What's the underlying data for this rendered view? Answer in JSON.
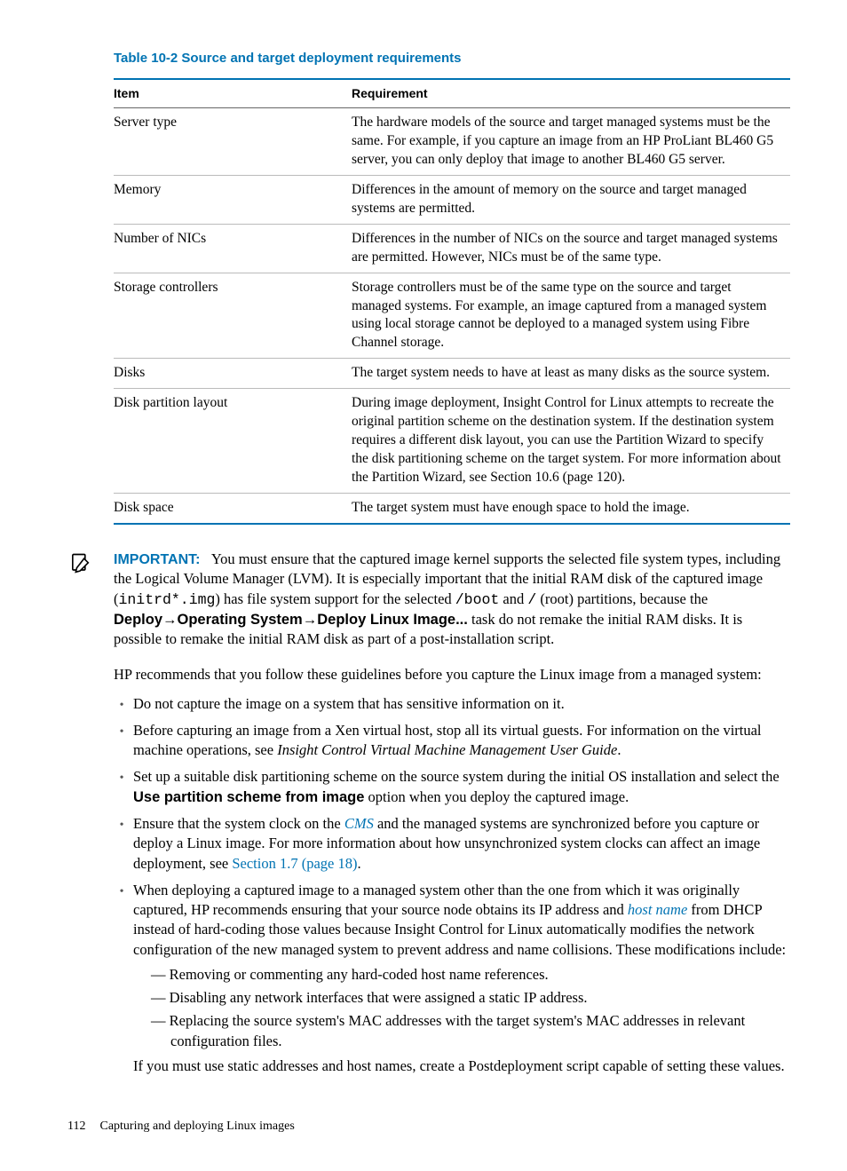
{
  "table": {
    "caption": "Table 10-2 Source and target deployment requirements",
    "header_item": "Item",
    "header_req": "Requirement",
    "rows": [
      {
        "item": "Server type",
        "req": "The hardware models of the source and target managed systems must be the same. For example, if you capture an image from an HP ProLiant BL460 G5 server, you can only deploy that image to another BL460 G5 server."
      },
      {
        "item": "Memory",
        "req": "Differences in the amount of memory on the source and target managed systems are permitted."
      },
      {
        "item": "Number of NICs",
        "req": "Differences in the number of NICs on the source and target managed systems are permitted. However, NICs must be of the same type."
      },
      {
        "item": "Storage controllers",
        "req": "Storage controllers must be of the same type on the source and target managed systems. For example, an image captured from a managed system using local storage cannot be deployed to a managed system using Fibre Channel storage."
      },
      {
        "item": "Disks",
        "req": "The target system needs to have at least as many disks as the source system."
      },
      {
        "item": "Disk partition layout",
        "req": "During image deployment, Insight Control for Linux attempts to recreate the original partition scheme on the destination system. If the destination system requires a different disk layout, you can use the Partition Wizard to specify the disk partitioning scheme on the target system. For more information about the Partition Wizard, see Section 10.6 (page 120)."
      },
      {
        "item": "Disk space",
        "req": "The target system must have enough space to hold the image."
      }
    ]
  },
  "important": {
    "label": "IMPORTANT:",
    "pre1": "You must ensure that the captured image kernel supports the selected file system types, including the Logical Volume Manager (LVM). It is especially important that the initial RAM disk of the captured image (",
    "mono1": "initrd*.img",
    "mid1": ") has file system support for the selected ",
    "mono2": "/boot",
    "mid2": " and ",
    "mono3": "/",
    "mid3": " (root) partitions, because the ",
    "bold1": "Deploy",
    "arrow": "→",
    "bold2": "Operating System",
    "bold3": "Deploy Linux Image...",
    "post1": " task do not remake the initial RAM disks. It is possible to remake the initial RAM disk as part of a post-installation script."
  },
  "para_intro": "HP recommends that you follow these guidelines before you capture the Linux image from a managed system:",
  "bullets": {
    "b1": "Do not capture the image on a system that has sensitive information on it.",
    "b2a": "Before capturing an image from a Xen virtual host, stop all its virtual guests. For information on the virtual machine operations, see ",
    "b2_italic": "Insight Control Virtual Machine Management User Guide",
    "b2b": ".",
    "b3a": "Set up a suitable disk partitioning scheme on the source system during the initial OS installation and select the ",
    "b3_bold": "Use partition scheme from image",
    "b3b": " option when you deploy the captured image.",
    "b4a": "Ensure that the system clock on the ",
    "b4_link1": "CMS",
    "b4b": " and the managed systems are synchronized before you capture or deploy a Linux image. For more information about how unsynchronized system clocks can affect an image deployment, see ",
    "b4_link2": "Section 1.7 (page 18)",
    "b4c": ".",
    "b5a": "When deploying a captured image to a managed system other than the one from which it was originally captured, HP recommends ensuring that your source node obtains its IP address and ",
    "b5_link": "host name",
    "b5b": " from DHCP instead of hard-coding those values because Insight Control for Linux automatically modifies the network configuration of the new managed system to prevent address and name collisions. These modifications include:",
    "b5_sub1": "Removing or commenting any hard-coded host name references.",
    "b5_sub2": "Disabling any network interfaces that were assigned a static IP address.",
    "b5_sub3": "Replacing the source system's MAC addresses with the target system's MAC addresses in relevant configuration files.",
    "b5_tail": "If you must use static addresses and host names, create a Postdeployment script capable of setting these values."
  },
  "footer": {
    "page": "112",
    "title": "Capturing and deploying Linux images"
  }
}
